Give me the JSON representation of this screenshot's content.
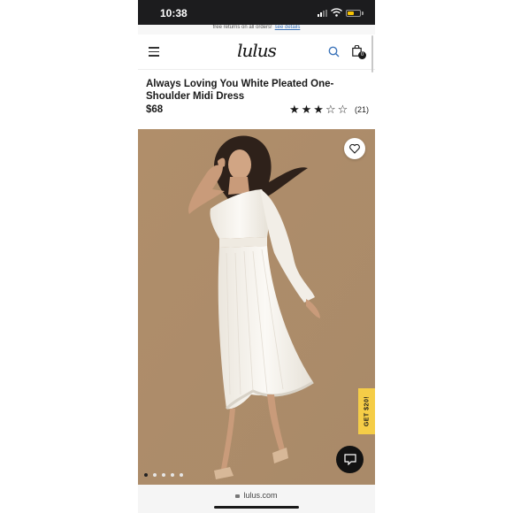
{
  "status": {
    "time": "10:38"
  },
  "promo": {
    "text": "free returns on all orders!",
    "link": "see details"
  },
  "header": {
    "logo": "lulus",
    "bag_count": "0"
  },
  "product": {
    "title": "Always Loving You White Pleated One-Shoulder Midi Dress",
    "price": "$68",
    "rating": 3,
    "rating_max": 5,
    "stars": "★★★☆☆",
    "review_count": "(21)"
  },
  "gallery": {
    "image_count": 5,
    "active_index": 0
  },
  "promo_tab": {
    "label": "GET $20!"
  },
  "browser": {
    "url": "lulus.com"
  },
  "colors": {
    "accent": "#f5cd47",
    "link": "#3b73b9",
    "background": "#b2926f",
    "dress": "#f7f4ee"
  }
}
